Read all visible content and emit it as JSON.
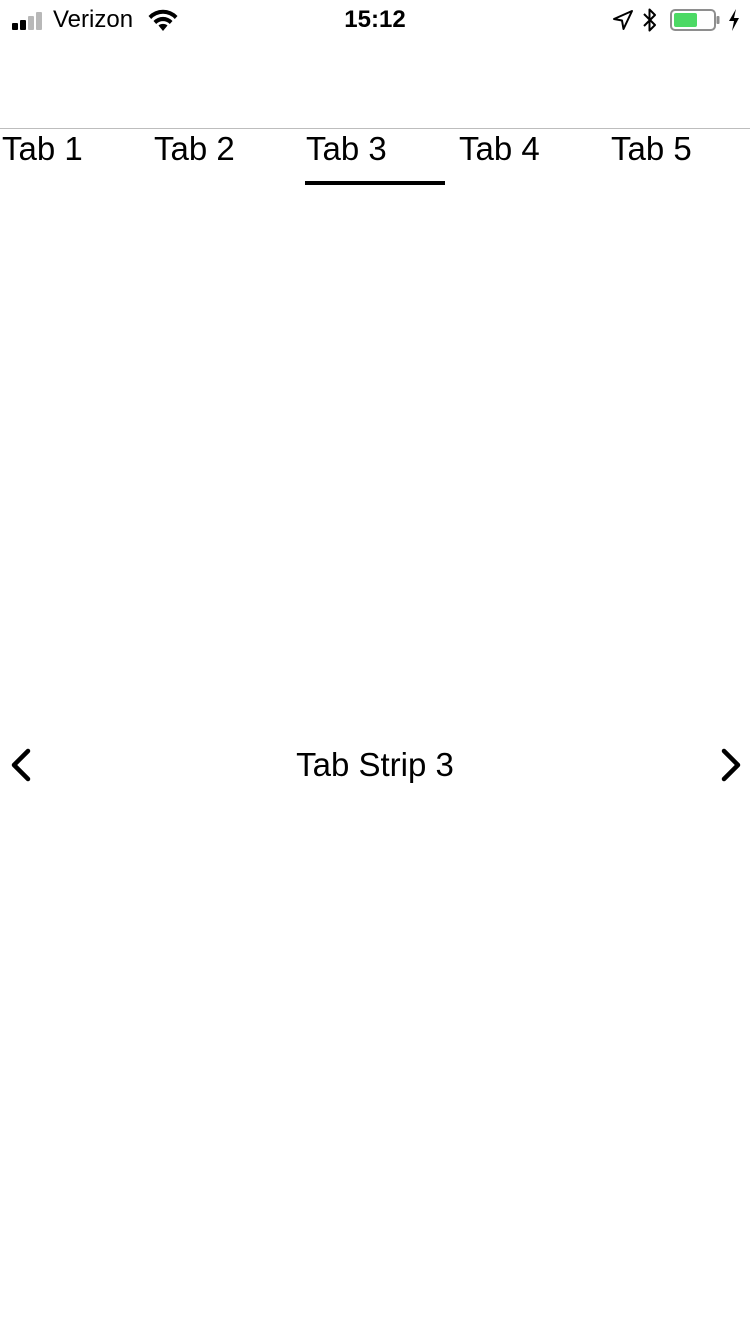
{
  "status_bar": {
    "carrier": "Verizon",
    "time": "15:12",
    "signal_bars_active": 2,
    "signal_bars_total": 4,
    "battery_level": 0.6,
    "icons": [
      "signal-icon",
      "wifi-icon",
      "location-arrow-icon",
      "bluetooth-icon",
      "battery-icon",
      "charging-bolt-icon"
    ],
    "battery_color": "#4cd964"
  },
  "tabs": [
    {
      "label": "Tab 1"
    },
    {
      "label": "Tab 2"
    },
    {
      "label": "Tab 3"
    },
    {
      "label": "Tab 4"
    },
    {
      "label": "Tab 5"
    }
  ],
  "selected_tab_index": 2,
  "content": {
    "title": "Tab Strip 3",
    "prev_icon": "chevron-left-icon",
    "next_icon": "chevron-right-icon"
  },
  "colors": {
    "background": "#ffffff",
    "text": "#000000",
    "divider": "#bdbdbd",
    "indicator": "#000000"
  }
}
